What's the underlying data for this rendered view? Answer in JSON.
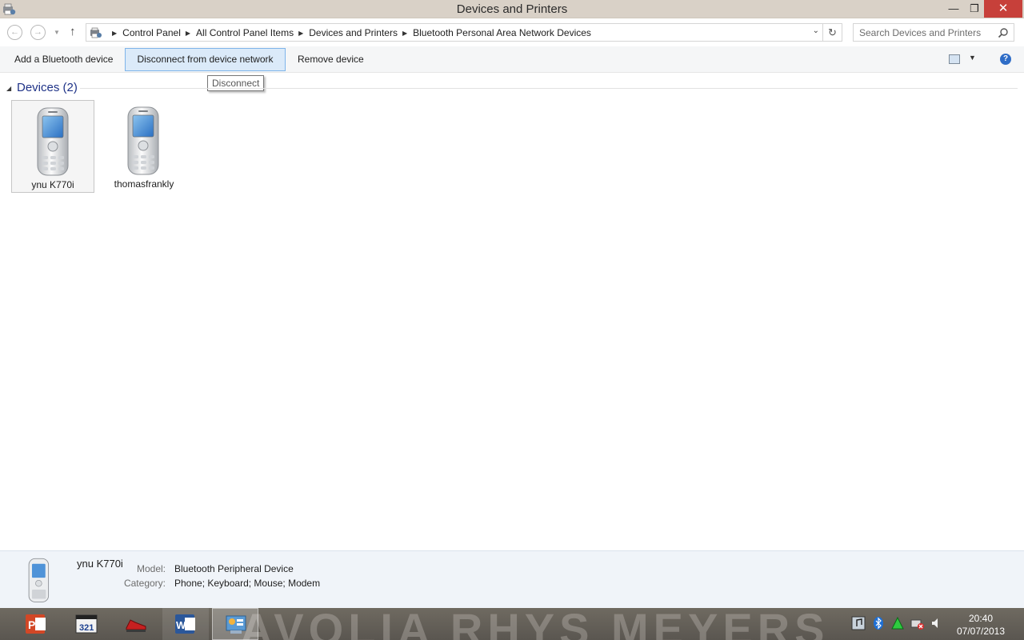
{
  "window": {
    "title": "Devices and Printers",
    "controls": {
      "minimize": "—",
      "maximize": "❐",
      "close": "✕"
    }
  },
  "nav": {
    "back": "←",
    "forward": "→",
    "recent": "▼",
    "up": "↑",
    "breadcrumbs": [
      "Control Panel",
      "All Control Panel Items",
      "Devices and Printers",
      "Bluetooth Personal Area Network Devices"
    ],
    "refresh": "↻",
    "search_placeholder": "Search Devices and Printers"
  },
  "commands": {
    "add": "Add a Bluetooth device",
    "disconnect": "Disconnect from device network",
    "remove": "Remove device",
    "view_dropdown": "▼",
    "help": "?"
  },
  "tooltip": "Disconnect",
  "group": {
    "title": "Devices (2)",
    "toggle": "◢"
  },
  "devices": [
    {
      "name": "ynu K770i",
      "icon": "mobile-phone-icon",
      "selected": true
    },
    {
      "name": "thomasfrankly",
      "icon": "mobile-phone-icon",
      "selected": false
    }
  ],
  "details": {
    "name": "ynu K770i",
    "model_label": "Model:",
    "model": "Bluetooth Peripheral Device",
    "category_label": "Category:",
    "category": "Phone; Keyboard; Mouse; Modem"
  },
  "taskbar": {
    "wallpaper_text": "AVOLIA   RHYS MEYERS",
    "apps": [
      {
        "name": "powerpoint",
        "icon": "powerpoint-icon",
        "state": "pinned"
      },
      {
        "name": "media-player-classic",
        "icon": "media-player-icon",
        "state": "pinned"
      },
      {
        "name": "sneaker-app",
        "icon": "shoe-icon",
        "state": "pinned"
      },
      {
        "name": "word",
        "icon": "word-icon",
        "state": "open"
      },
      {
        "name": "control-panel",
        "icon": "control-panel-icon",
        "state": "active"
      }
    ],
    "clock": {
      "time": "20:40",
      "date": "07/07/2013"
    }
  },
  "colors": {
    "title_bar": "#d9d1c7",
    "close_button": "#c7403a",
    "selected_command": "#dbeaf9",
    "group_title": "#1e3287",
    "details_pane": "#f0f4f9"
  }
}
